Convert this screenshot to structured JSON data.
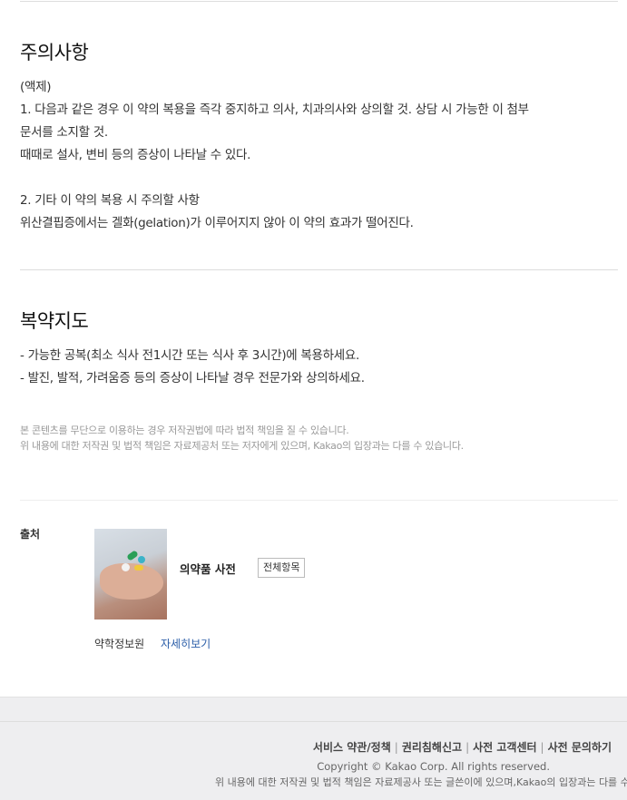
{
  "caution": {
    "title": "주의사항",
    "body": "(액제)\n1. 다음과 같은 경우 이 약의 복용을 즉각 중지하고 의사, 치과의사와 상의할 것. 상담 시 가능한 이 첨부\n문서를 소지할 것.\n때때로 설사, 변비 등의 증상이 나타날 수 있다.\n\n2. 기타 이 약의 복용 시 주의할 사항\n위산결핍증에서는 겔화(gelation)가 이루어지지 않아 이 약의 효과가 떨어진다."
  },
  "guidance": {
    "title": "복약지도",
    "body": "- 가능한 공복(최소 식사 전1시간 또는 식사 후 3시간)에 복용하세요.\n- 발진, 발적, 가려움증 등의 증상이 나타날 경우 전문가와 상의하세요."
  },
  "notice": {
    "line1": "본 콘텐츠를 무단으로 이용하는 경우 저작권법에 따라 법적 책임을 질 수 있습니다.",
    "line2": "위 내용에 대한 저작권 및 법적 책임은 자료제공처 또는 저자에게 있으며, Kakao의 입장과는 다를 수 있습니다."
  },
  "source": {
    "label": "출처",
    "dictionary": "의약품 사전",
    "all_items": "전체항목",
    "provider": "약학정보원",
    "more": "자세히보기"
  },
  "footer": {
    "links": [
      "서비스 약관/정책",
      "권리침해신고",
      "사전 고객센터",
      "사전 문의하기"
    ],
    "copyright": "Copyright © Kakao Corp. All rights reserved.",
    "disclaimer": "위 내용에 대한 저작권 및 법적 책임은 자료제공사 또는 글쓴이에 있으며,Kakao의 입장과는 다를 수 있"
  }
}
